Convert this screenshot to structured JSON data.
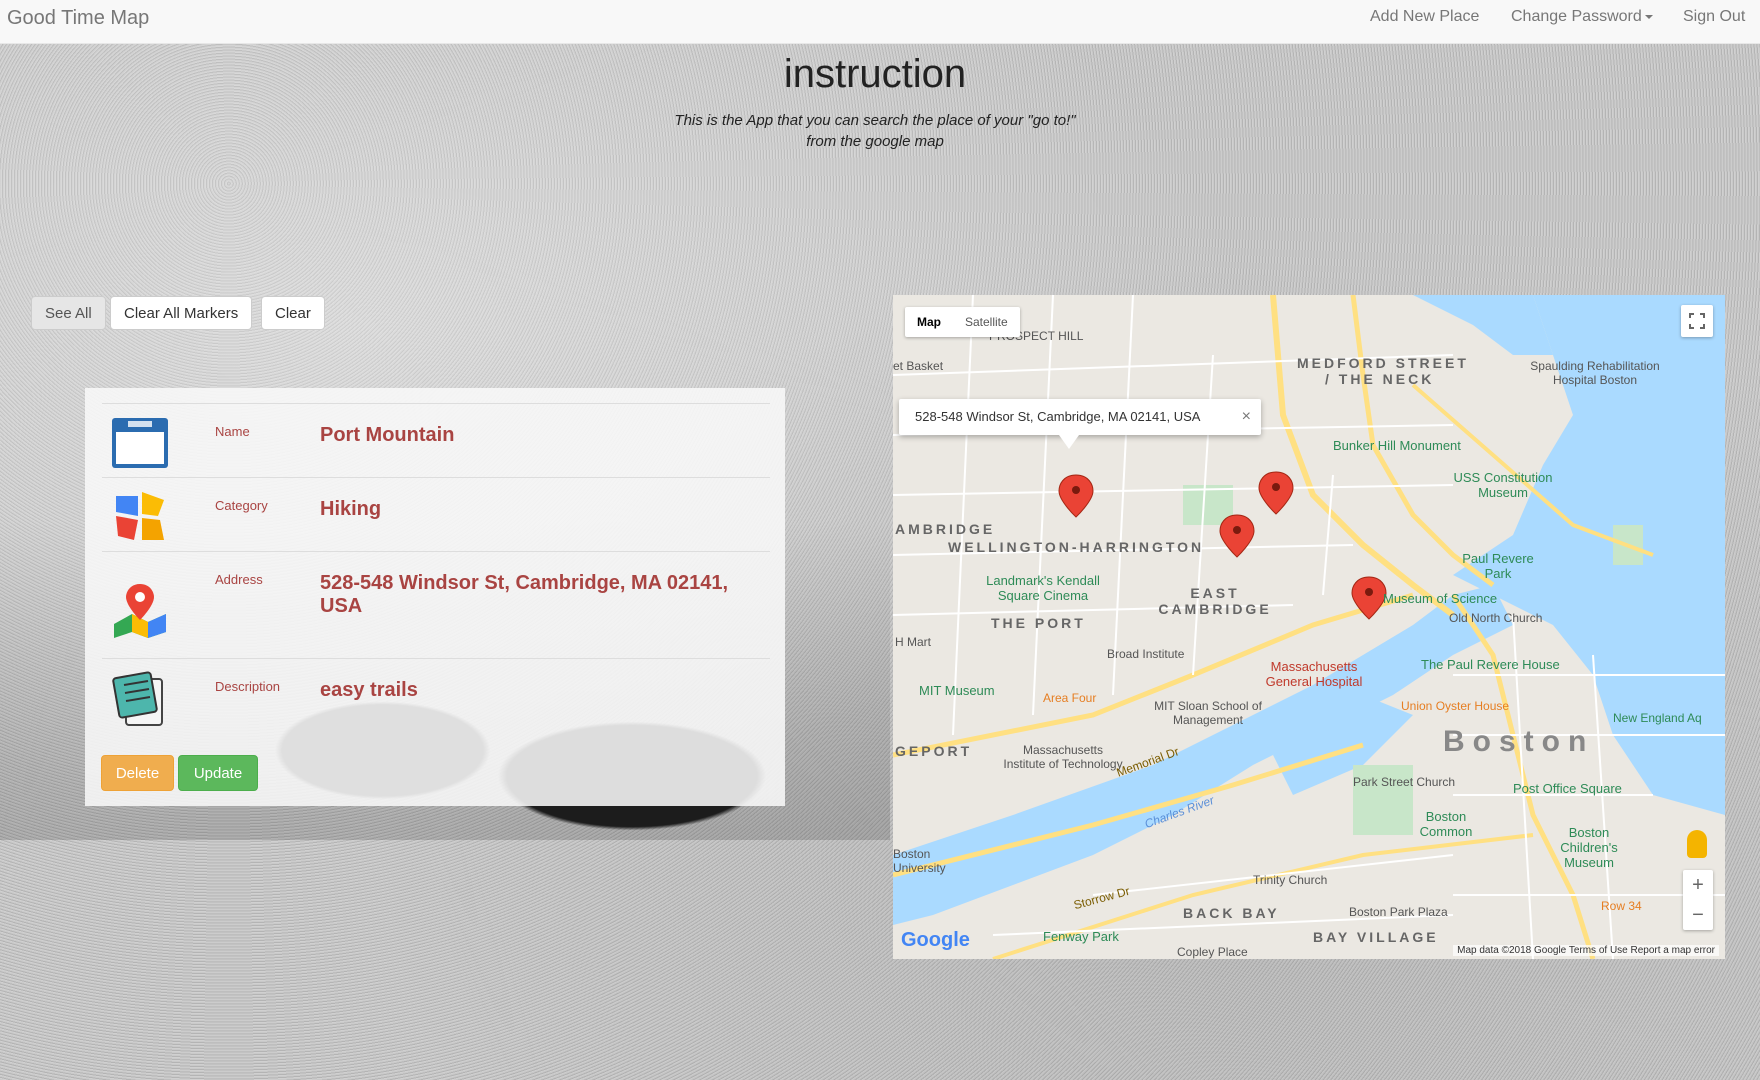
{
  "navbar": {
    "brand": "Good Time Map",
    "add_new_place": "Add New Place",
    "change_password": "Change Password",
    "sign_out": "Sign Out"
  },
  "instruction": {
    "title": "instruction",
    "line1": "This is the App that you can search the place of your \"go to!\"",
    "line2": "from the google map"
  },
  "actions": {
    "see_all": "See All",
    "clear_all_markers": "Clear All Markers",
    "clear": "Clear"
  },
  "place_card": {
    "rows": [
      {
        "label": "Name",
        "value": "Port Mountain",
        "icon": "name-tag-icon"
      },
      {
        "label": "Category",
        "value": "Hiking",
        "icon": "category-icon"
      },
      {
        "label": "Address",
        "value": "528-548 Windsor St, Cambridge, MA 02141, USA",
        "icon": "map-pin-icon"
      },
      {
        "label": "Description",
        "value": "easy trails",
        "icon": "notepad-icon"
      }
    ],
    "delete_label": "Delete",
    "update_label": "Update"
  },
  "map": {
    "map_type_map": "Map",
    "map_type_satellite": "Satellite",
    "info_window_address": "528-548 Windsor St, Cambridge, MA 02141, USA",
    "info_window_close": "×",
    "zoom_in": "+",
    "zoom_out": "−",
    "google_logo": "Google",
    "attribution": "Map data ©2018 Google   Terms of Use   Report a map error",
    "labels": {
      "prospect_hill": "PROSPECT HILL",
      "medford_street": "MEDFORD STREET",
      "the_neck": "/ THE NECK",
      "spaulding": "Spaulding Rehabilitation Hospital Boston",
      "bunker_hill": "Bunker Hill Monument",
      "uss_constitution": "USS Constitution Museum",
      "wellington": "WELLINGTON-HARRINGTON",
      "east_cambridge": "EAST CAMBRIDGE",
      "the_port": "THE PORT",
      "landmarks": "Landmark's Kendall Square Cinema",
      "paul_revere_park": "Paul Revere Park",
      "museum_science": "Museum of Science",
      "old_north": "Old North Church",
      "broad_institute": "Broad Institute",
      "mass_general": "Massachusetts General Hospital",
      "paul_revere_house": "The Paul Revere House",
      "mit_museum": "MIT Museum",
      "area_four": "Area Four",
      "mit_sloan": "MIT Sloan School of Management",
      "union_oyster": "Union Oyster House",
      "boston": "Boston",
      "mit": "Massachusetts Institute of Technology",
      "memorial_dr": "Memorial Dr",
      "charles_river": "Charles River",
      "park_street": "Park Street Church",
      "post_office_sq": "Post Office Square",
      "boston_common": "Boston Common",
      "childrens_museum": "Boston Children's Museum",
      "trinity": "Trinity Church",
      "back_bay": "BACK BAY",
      "bay_village": "BAY VILLAGE",
      "boston_park_plaza": "Boston Park Plaza",
      "fenway_park": "Fenway Park",
      "copley": "Copley Place",
      "storrow": "Storrow Dr",
      "new_england_aq": "New England Aq",
      "boston_university": "Boston University",
      "geport": "GEPORT",
      "ambridge": "AMBRIDGE",
      "h_mart": "H Mart",
      "et_basket": "et Basket",
      "row34": "Row 34"
    }
  }
}
